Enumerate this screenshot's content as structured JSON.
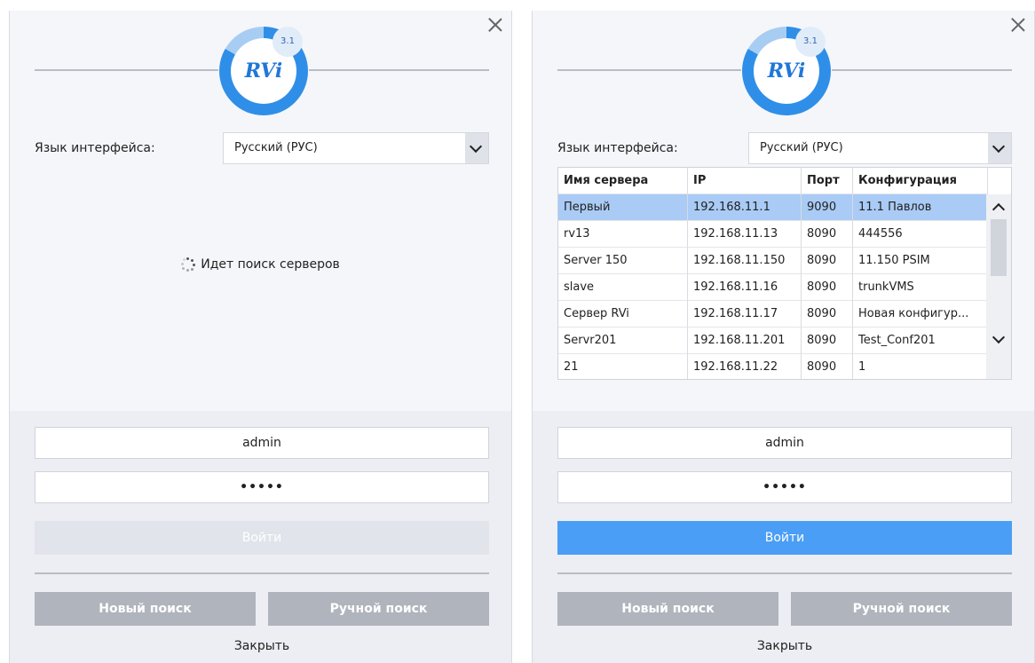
{
  "logo": {
    "version": "3.1",
    "text": "RVi"
  },
  "left_panel": {
    "language_label": "Язык интерфейса:",
    "language_value": "Русский (РУС)",
    "searching_text": "Идет поиск серверов",
    "username": "admin",
    "password_mask": "•••••",
    "login_label": "Войти",
    "new_search_label": "Новый поиск",
    "manual_search_label": "Ручной поиск",
    "close_label": "Закрыть"
  },
  "right_panel": {
    "language_label": "Язык интерфейса:",
    "language_value": "Русский (РУС)",
    "table": {
      "headers": [
        "Имя сервера",
        "IP",
        "Порт",
        "Конфигурация"
      ],
      "rows": [
        {
          "name": "Первый",
          "ip": "192.168.11.1",
          "port": "9090",
          "config": "11.1 Павлов"
        },
        {
          "name": "rv13",
          "ip": "192.168.11.13",
          "port": "8090",
          "config": "444556"
        },
        {
          "name": "Server 150",
          "ip": "192.168.11.150",
          "port": "8090",
          "config": "11.150 PSIM"
        },
        {
          "name": "slave",
          "ip": "192.168.11.16",
          "port": "8090",
          "config": "trunkVMS"
        },
        {
          "name": "Сервер RVi",
          "ip": "192.168.11.17",
          "port": "8090",
          "config": "Новая конфигур..."
        },
        {
          "name": "Servr201",
          "ip": "192.168.11.201",
          "port": "8090",
          "config": "Test_Conf201"
        },
        {
          "name": "21",
          "ip": "192.168.11.22",
          "port": "8090",
          "config": "1"
        }
      ]
    },
    "username": "admin",
    "password_mask": "•••••",
    "login_label": "Войти",
    "new_search_label": "Новый поиск",
    "manual_search_label": "Ручной поиск",
    "close_label": "Закрыть"
  },
  "colors": {
    "accent": "#4a9ef5",
    "logo_ring": "#2f8fe8",
    "selected_row": "#a9cbf5"
  }
}
